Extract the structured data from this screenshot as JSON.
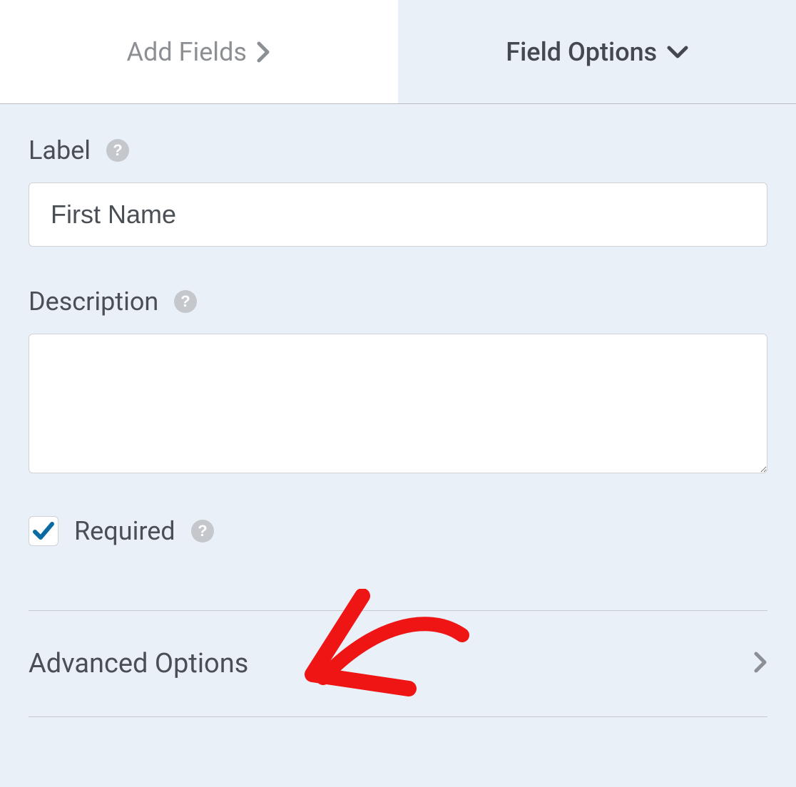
{
  "tabs": {
    "add_fields_label": "Add Fields",
    "field_options_label": "Field Options"
  },
  "fields": {
    "label": {
      "label": "Label",
      "value": "First Name"
    },
    "description": {
      "label": "Description",
      "value": ""
    },
    "required": {
      "label": "Required",
      "checked": true
    }
  },
  "sections": {
    "advanced_options_label": "Advanced Options"
  }
}
